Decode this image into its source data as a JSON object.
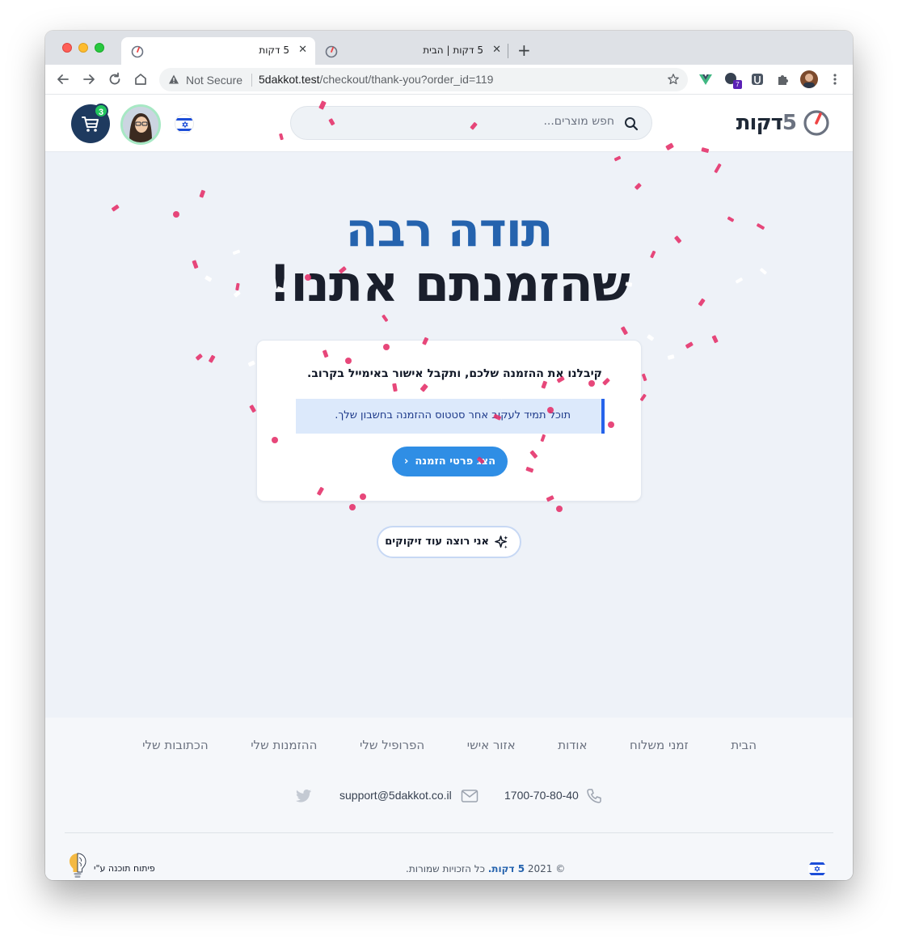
{
  "browser": {
    "tabs": [
      {
        "title": "5 דקות",
        "active": true
      },
      {
        "title": "5 דקות | הבית",
        "active": false
      }
    ],
    "security_label": "Not Secure",
    "url_host": "5dakkot.test",
    "url_path": "/checkout/thank-you?order_id=119",
    "extension_badge": "7"
  },
  "header": {
    "logo_number": "5",
    "logo_text": "דקות",
    "search_placeholder": "חפש מוצרים...",
    "cart_count": "3"
  },
  "hero": {
    "line1": "תודה רבה",
    "line2": "שהזמנתם אתנו!"
  },
  "card": {
    "title": "קיבלנו את ההזמנה שלכם, ותקבל אישור באימייל בקרוב.",
    "info": "תוכל תמיד לעקוב אחר סטטוס ההזמנה בחשבון שלך.",
    "button_label": "הצג פרטי הזמנה"
  },
  "confetti_button": {
    "label": "אני רוצה עוד זיקוקים"
  },
  "footer": {
    "links": [
      "הבית",
      "זמני משלוח",
      "אודות",
      "אזור אישי",
      "הפרופיל שלי",
      "ההזמנות שלי",
      "הכתובות שלי"
    ],
    "phone": "1700-70-80-40",
    "email": "support@5dakkot.co.il",
    "copyright_symbol_year": "© 2021",
    "copyright_brand": "5 דקות.",
    "copyright_text": "כל הזכויות שמורות.",
    "developed_by": "פיתוח תוכנה ע\"י"
  },
  "colors": {
    "brand_blue": "#2563ae",
    "accent_red": "#ef4444",
    "confetti": "#e5336b",
    "button_blue": "#2f8ee5"
  }
}
